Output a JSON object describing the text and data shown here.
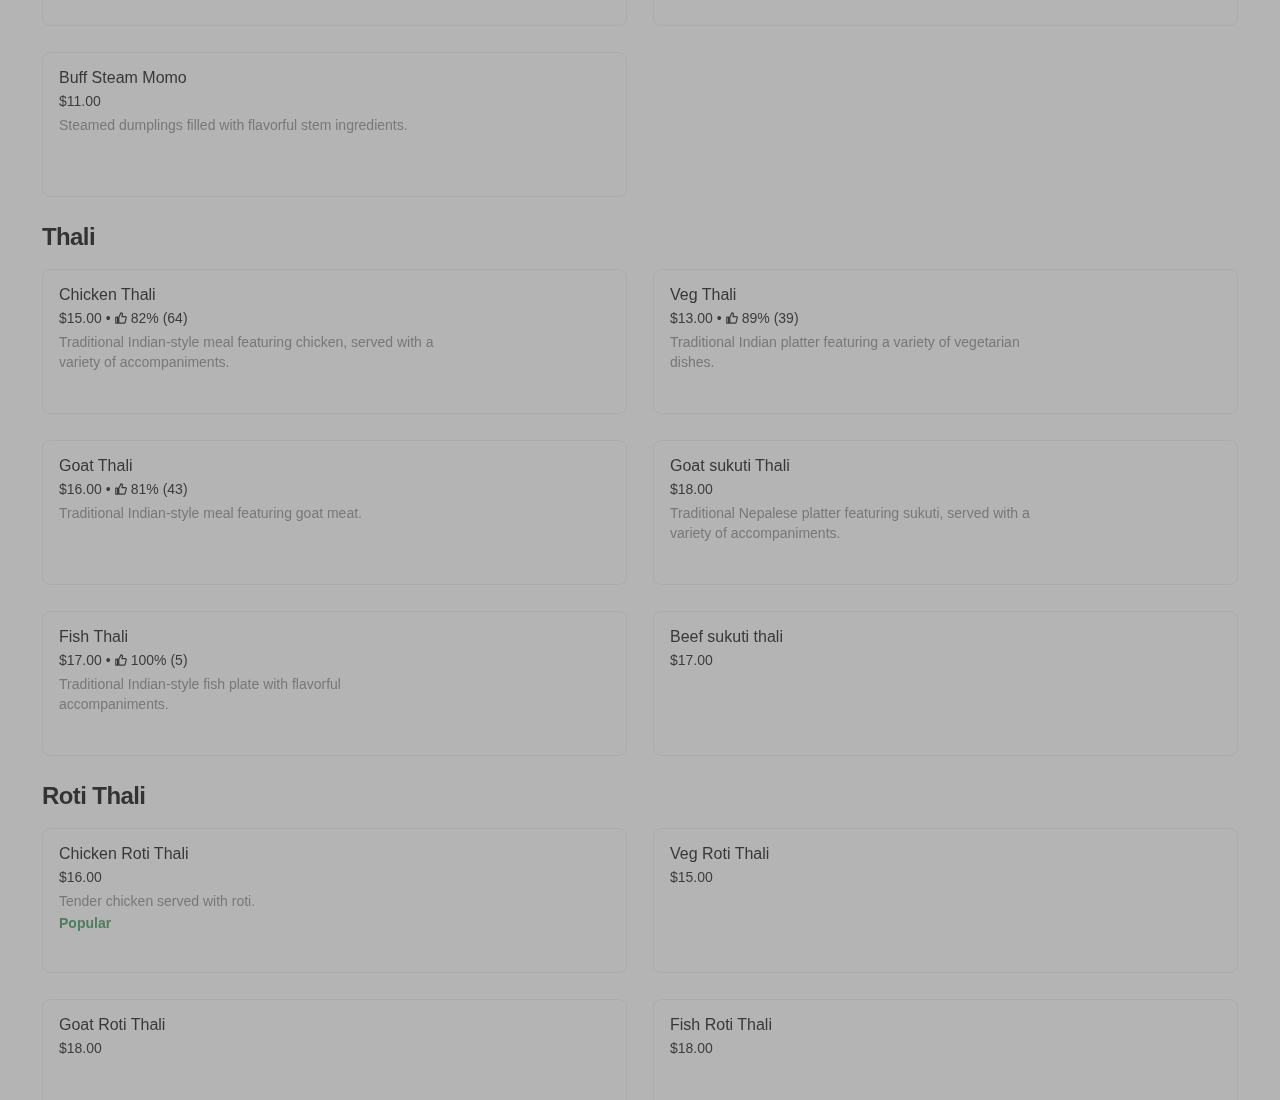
{
  "page": {
    "dimmed": true
  },
  "sections": [
    {
      "items": [
        {
          "kind": "clipped"
        },
        {
          "kind": "clipped"
        },
        {
          "kind": "item",
          "name": "Buff Steam Momo",
          "price": "$11.00",
          "description": "Steamed dumplings filled with flavorful stem ingredients."
        }
      ]
    },
    {
      "heading": "Thali",
      "items": [
        {
          "kind": "item",
          "name": "Chicken Thali",
          "price": "$15.00",
          "separator": "•",
          "rating": "82% (64)",
          "description": "Traditional Indian-style meal featuring chicken, served with a variety of accompaniments."
        },
        {
          "kind": "item",
          "name": "Veg Thali",
          "price": "$13.00",
          "separator": "•",
          "rating": "89% (39)",
          "description": "Traditional Indian platter featuring a variety of vegetarian dishes."
        },
        {
          "kind": "item",
          "name": "Goat Thali",
          "price": "$16.00",
          "separator": "•",
          "rating": "81% (43)",
          "description": "Traditional Indian-style meal featuring goat meat."
        },
        {
          "kind": "item",
          "name": "Goat sukuti Thali",
          "price": "$18.00",
          "description": "Traditional Nepalese platter featuring sukuti, served with a variety of accompaniments."
        },
        {
          "kind": "item",
          "name": "Fish Thali",
          "price": "$17.00",
          "separator": "•",
          "rating": "100% (5)",
          "description": "Traditional Indian-style fish plate with flavorful accompaniments."
        },
        {
          "kind": "item",
          "name": "Beef sukuti thali",
          "price": "$17.00"
        }
      ]
    },
    {
      "heading": "Roti Thali",
      "items": [
        {
          "kind": "item",
          "name": "Chicken Roti Thali",
          "price": "$16.00",
          "description": "Tender chicken served with roti.",
          "badge": "Popular"
        },
        {
          "kind": "item",
          "name": "Veg Roti Thali",
          "price": "$15.00"
        },
        {
          "kind": "item",
          "name": "Goat Roti Thali",
          "price": "$18.00"
        },
        {
          "kind": "item",
          "name": "Fish Roti Thali",
          "price": "$18.00"
        }
      ]
    }
  ]
}
